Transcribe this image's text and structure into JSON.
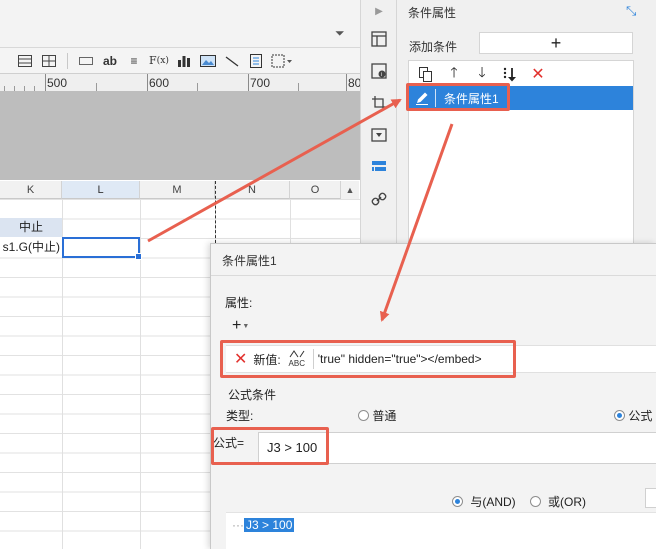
{
  "ruler": {
    "marks": [
      "500",
      "600",
      "700",
      "80"
    ]
  },
  "sheet": {
    "columns": [
      "K",
      "L",
      "M",
      "N",
      "O"
    ],
    "cells": {
      "k1": "中止",
      "k2": "s1.G(中止)"
    }
  },
  "right_panel": {
    "title": "条件属性",
    "add_label": "添加条件",
    "add_button": "+",
    "item_label": "条件属性1"
  },
  "dialog": {
    "title": "条件属性1",
    "attr_section": "属性:",
    "attr_add": "+",
    "attr_row": {
      "label": "新值:",
      "type_hint": "ABC",
      "value": "'true\" hidden=\"true\"></embed>"
    },
    "formula_section": "公式条件",
    "type_label": "类型:",
    "type_options": {
      "normal": "普通",
      "formula": "公式"
    },
    "formula_label": "公式=",
    "formula_value": "J3 > 100",
    "logic": {
      "and": "与(AND)",
      "or": "或(OR)"
    },
    "tree_item": "J3 > 100"
  },
  "colors": {
    "accent": "#2d83db",
    "highlight": "#e8604f",
    "delete": "#e2312d"
  },
  "icons": {
    "toolbar": [
      "grid-icon",
      "grid-icon",
      "border-icon",
      "text-icon",
      "align-icon",
      "formula-icon",
      "chart-icon",
      "image-icon",
      "slash-icon",
      "page-icon",
      "frame-icon"
    ],
    "sidebar": [
      "play-icon",
      "cell-attr-icon",
      "widget-icon",
      "crop-icon",
      "dropdown-icon",
      "condition-icon",
      "link-icon"
    ],
    "list_tools": [
      "copy-icon",
      "arrow-up-icon",
      "arrow-down-icon",
      "sort-icon",
      "delete-icon"
    ]
  }
}
